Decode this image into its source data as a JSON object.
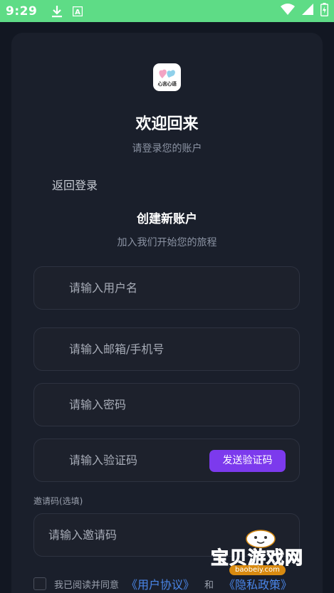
{
  "status": {
    "time": "9:29",
    "icons": [
      "download-icon",
      "a-notification-icon",
      "wifi-icon",
      "signal-icon",
      "battery-charging-icon"
    ]
  },
  "app": {
    "logo_text": "心言心语",
    "title": "欢迎回来",
    "subtitle": "请登录您的账户"
  },
  "nav": {
    "back_label": "返回登录"
  },
  "register": {
    "title": "创建新账户",
    "subtitle": "加入我们开始您的旅程",
    "username_placeholder": "请输入用户名",
    "contact_placeholder": "请输入邮箱/手机号",
    "password_placeholder": "请输入密码",
    "code_placeholder": "请输入验证码",
    "send_code_label": "发送验证码",
    "invite_label": "邀请码(选填)",
    "invite_placeholder": "请输入邀请码"
  },
  "agreement": {
    "prefix": "我已阅读并同意",
    "user_agreement": "《用户协议》",
    "and": "和",
    "privacy_policy": "《隐私政策》"
  },
  "watermark": {
    "text": "宝贝游戏网",
    "url": "baobeiy.com"
  },
  "colors": {
    "status_bar": "#5edc86",
    "background": "#121722",
    "card": "#1a1f2b",
    "accent": "#7c3aed",
    "link": "#4a86e8"
  }
}
